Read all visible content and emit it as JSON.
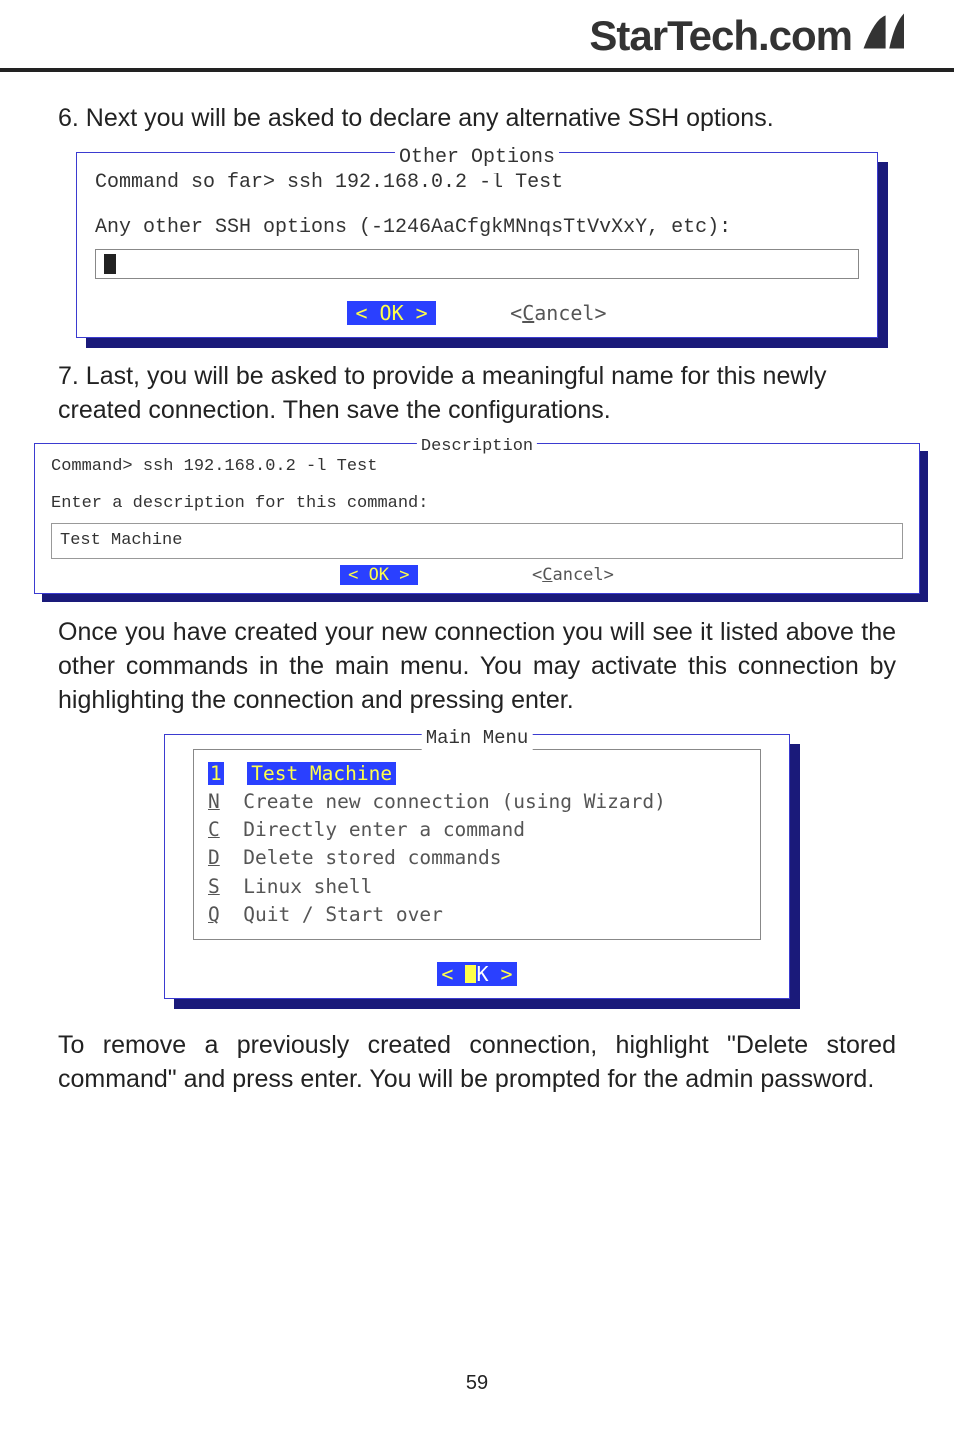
{
  "header": {
    "brand": "StarTech.com"
  },
  "step6_text": "6. Next you will be asked to declare any alternative SSH options.",
  "dialog1": {
    "title": "Other Options",
    "cmd": "Command so far> ssh 192.168.0.2 -l Test",
    "prompt": "Any other SSH options (-1246AaCfgkMNnqsTtVvXxY, etc):",
    "ok_label": "<  OK  >",
    "cancel_prefix": "<",
    "cancel_underline": "C",
    "cancel_rest": "ancel>"
  },
  "step7_text": "7. Last, you will be asked to provide a meaningful name for this newly created connection. Then save the configurations.",
  "dialog2": {
    "title": "Description",
    "cmd": "Command> ssh 192.168.0.2 -l Test",
    "prompt": "Enter a description for this command:",
    "input_value": "Test Machine",
    "ok_label": "<  OK  >",
    "cancel_prefix": "<",
    "cancel_underline": "C",
    "cancel_rest": "ancel>"
  },
  "para_after": "Once you have created your new connection you will see it listed above the other commands in the main menu. You may activate this connection by highlighting the connection and pressing enter.",
  "menu": {
    "title": "Main Menu",
    "hl_key": "1",
    "hl_label": "Test Machine",
    "rows": [
      {
        "key": "N",
        "label": "Create new connection (using Wizard)"
      },
      {
        "key": "C",
        "label": "Directly enter a command"
      },
      {
        "key": "D",
        "label": "Delete stored commands"
      },
      {
        "key": "S",
        "label": "Linux shell"
      },
      {
        "key": "Q",
        "label": "Quit / Start over"
      }
    ],
    "ok_bracket_l": "<  ",
    "ok_bracket_r": "  >"
  },
  "para_last": "To remove a previously created connection, highlight \"Delete stored command\" and press enter. You will be prompted for the admin password.",
  "page_number": "59"
}
